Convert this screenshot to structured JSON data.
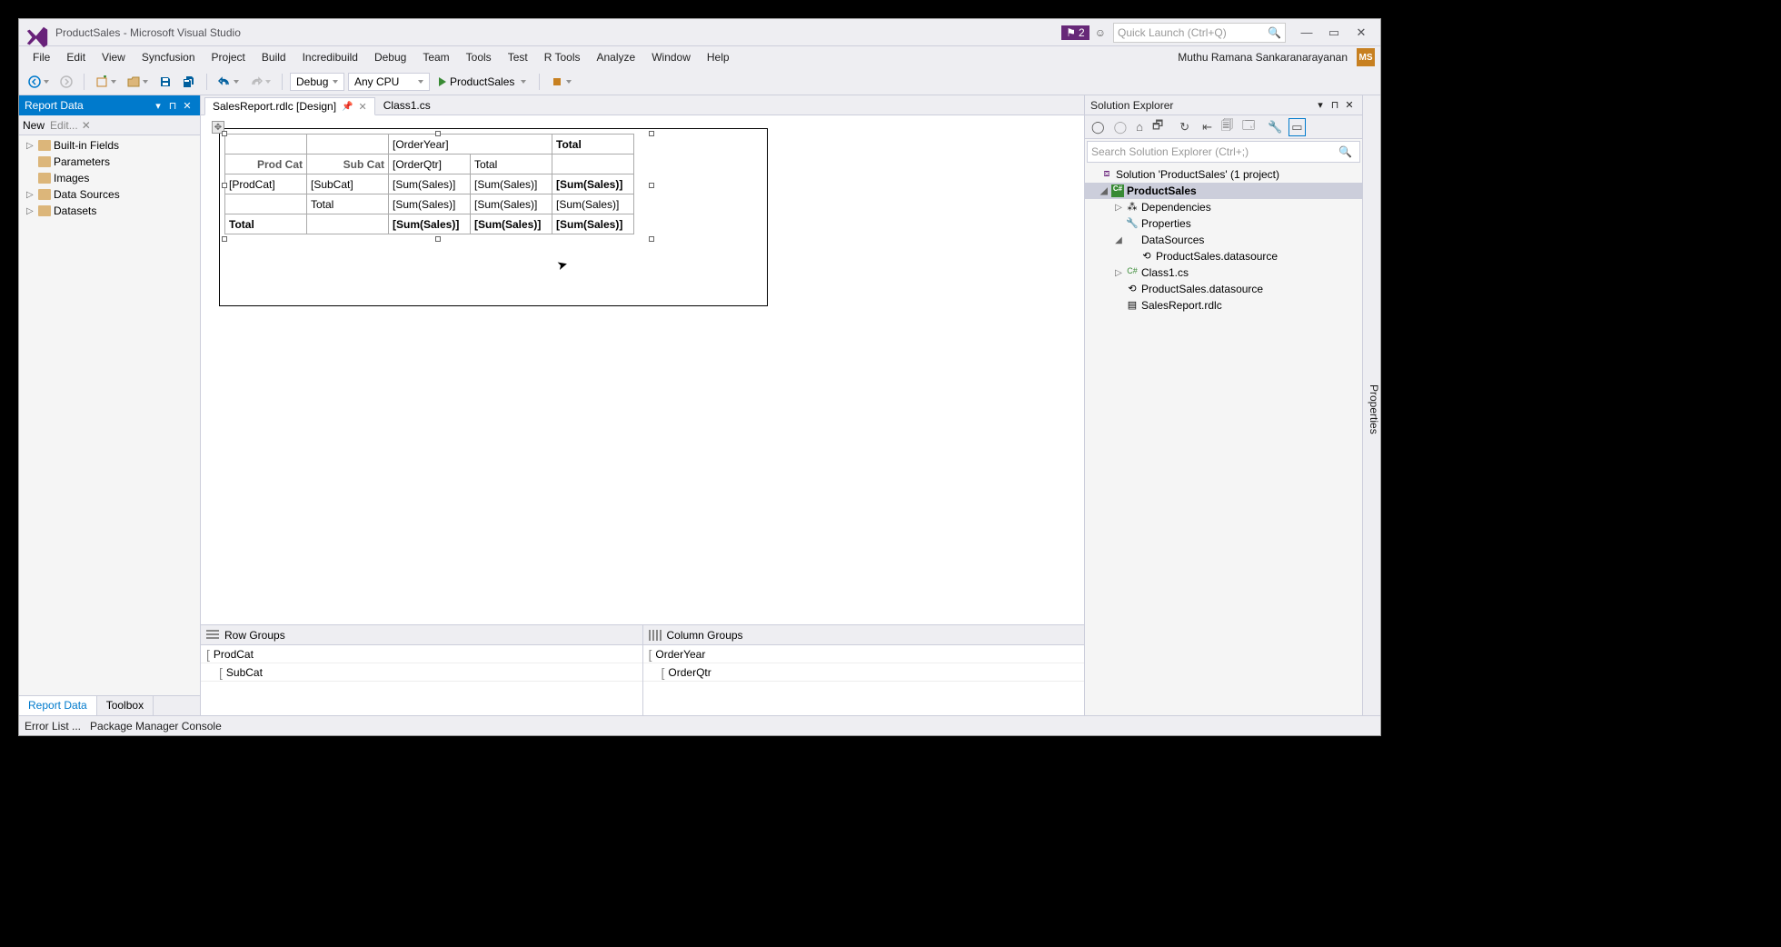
{
  "titlebar": {
    "title": "ProductSales - Microsoft Visual Studio",
    "notif_count": "2",
    "quick_launch_placeholder": "Quick Launch (Ctrl+Q)"
  },
  "menu": {
    "items": [
      "File",
      "Edit",
      "View",
      "Syncfusion",
      "Project",
      "Build",
      "Incredibuild",
      "Debug",
      "Team",
      "Tools",
      "Test",
      "R Tools",
      "Analyze",
      "Window",
      "Help"
    ],
    "user_name": "Muthu Ramana Sankaranarayanan",
    "user_initials": "MS"
  },
  "toolbar": {
    "config": "Debug",
    "platform": "Any CPU",
    "run_target": "ProductSales"
  },
  "report_data_panel": {
    "title": "Report Data",
    "toolbar": {
      "new": "New",
      "edit": "Edit..."
    },
    "items": [
      "Built-in Fields",
      "Parameters",
      "Images",
      "Data Sources",
      "Datasets"
    ],
    "tabs": {
      "report_data": "Report Data",
      "toolbox": "Toolbox"
    }
  },
  "doc_tabs": {
    "active": "SalesReport.rdlc [Design]",
    "other": "Class1.cs"
  },
  "tablix": {
    "r0": {
      "c0": "",
      "c1": "",
      "c2": "[OrderYear]",
      "c3": "",
      "c4": "Total"
    },
    "r1": {
      "c0": "Prod Cat",
      "c1": "Sub Cat",
      "c2": "[OrderQtr]",
      "c3": "Total",
      "c4": ""
    },
    "r2": {
      "c0": "[ProdCat]",
      "c1": "[SubCat]",
      "c2": "[Sum(Sales)]",
      "c3": "[Sum(Sales)]",
      "c4": "[Sum(Sales)]"
    },
    "r3": {
      "c0": "",
      "c1": "Total",
      "c2": "[Sum(Sales)]",
      "c3": "[Sum(Sales)]",
      "c4": "[Sum(Sales)]"
    },
    "r4": {
      "c0": "Total",
      "c1": "",
      "c2": "[Sum(Sales)]",
      "c3": "[Sum(Sales)]",
      "c4": "[Sum(Sales)]"
    }
  },
  "groups": {
    "row_title": "Row Groups",
    "col_title": "Column Groups",
    "rows": [
      "ProdCat",
      "SubCat"
    ],
    "cols": [
      "OrderYear",
      "OrderQtr"
    ]
  },
  "solution_explorer": {
    "title": "Solution Explorer",
    "search_placeholder": "Search Solution Explorer (Ctrl+;)",
    "root": "Solution 'ProductSales' (1 project)",
    "project": "ProductSales",
    "nodes": {
      "dependencies": "Dependencies",
      "properties": "Properties",
      "datasources_folder": "DataSources",
      "datasources_item": "ProductSales.datasource",
      "class1": "Class1.cs",
      "ds_item2": "ProductSales.datasource",
      "rdlc": "SalesReport.rdlc"
    }
  },
  "properties_tab": "Properties",
  "statusbar": {
    "error_list": "Error List ...",
    "pmc": "Package Manager Console"
  }
}
